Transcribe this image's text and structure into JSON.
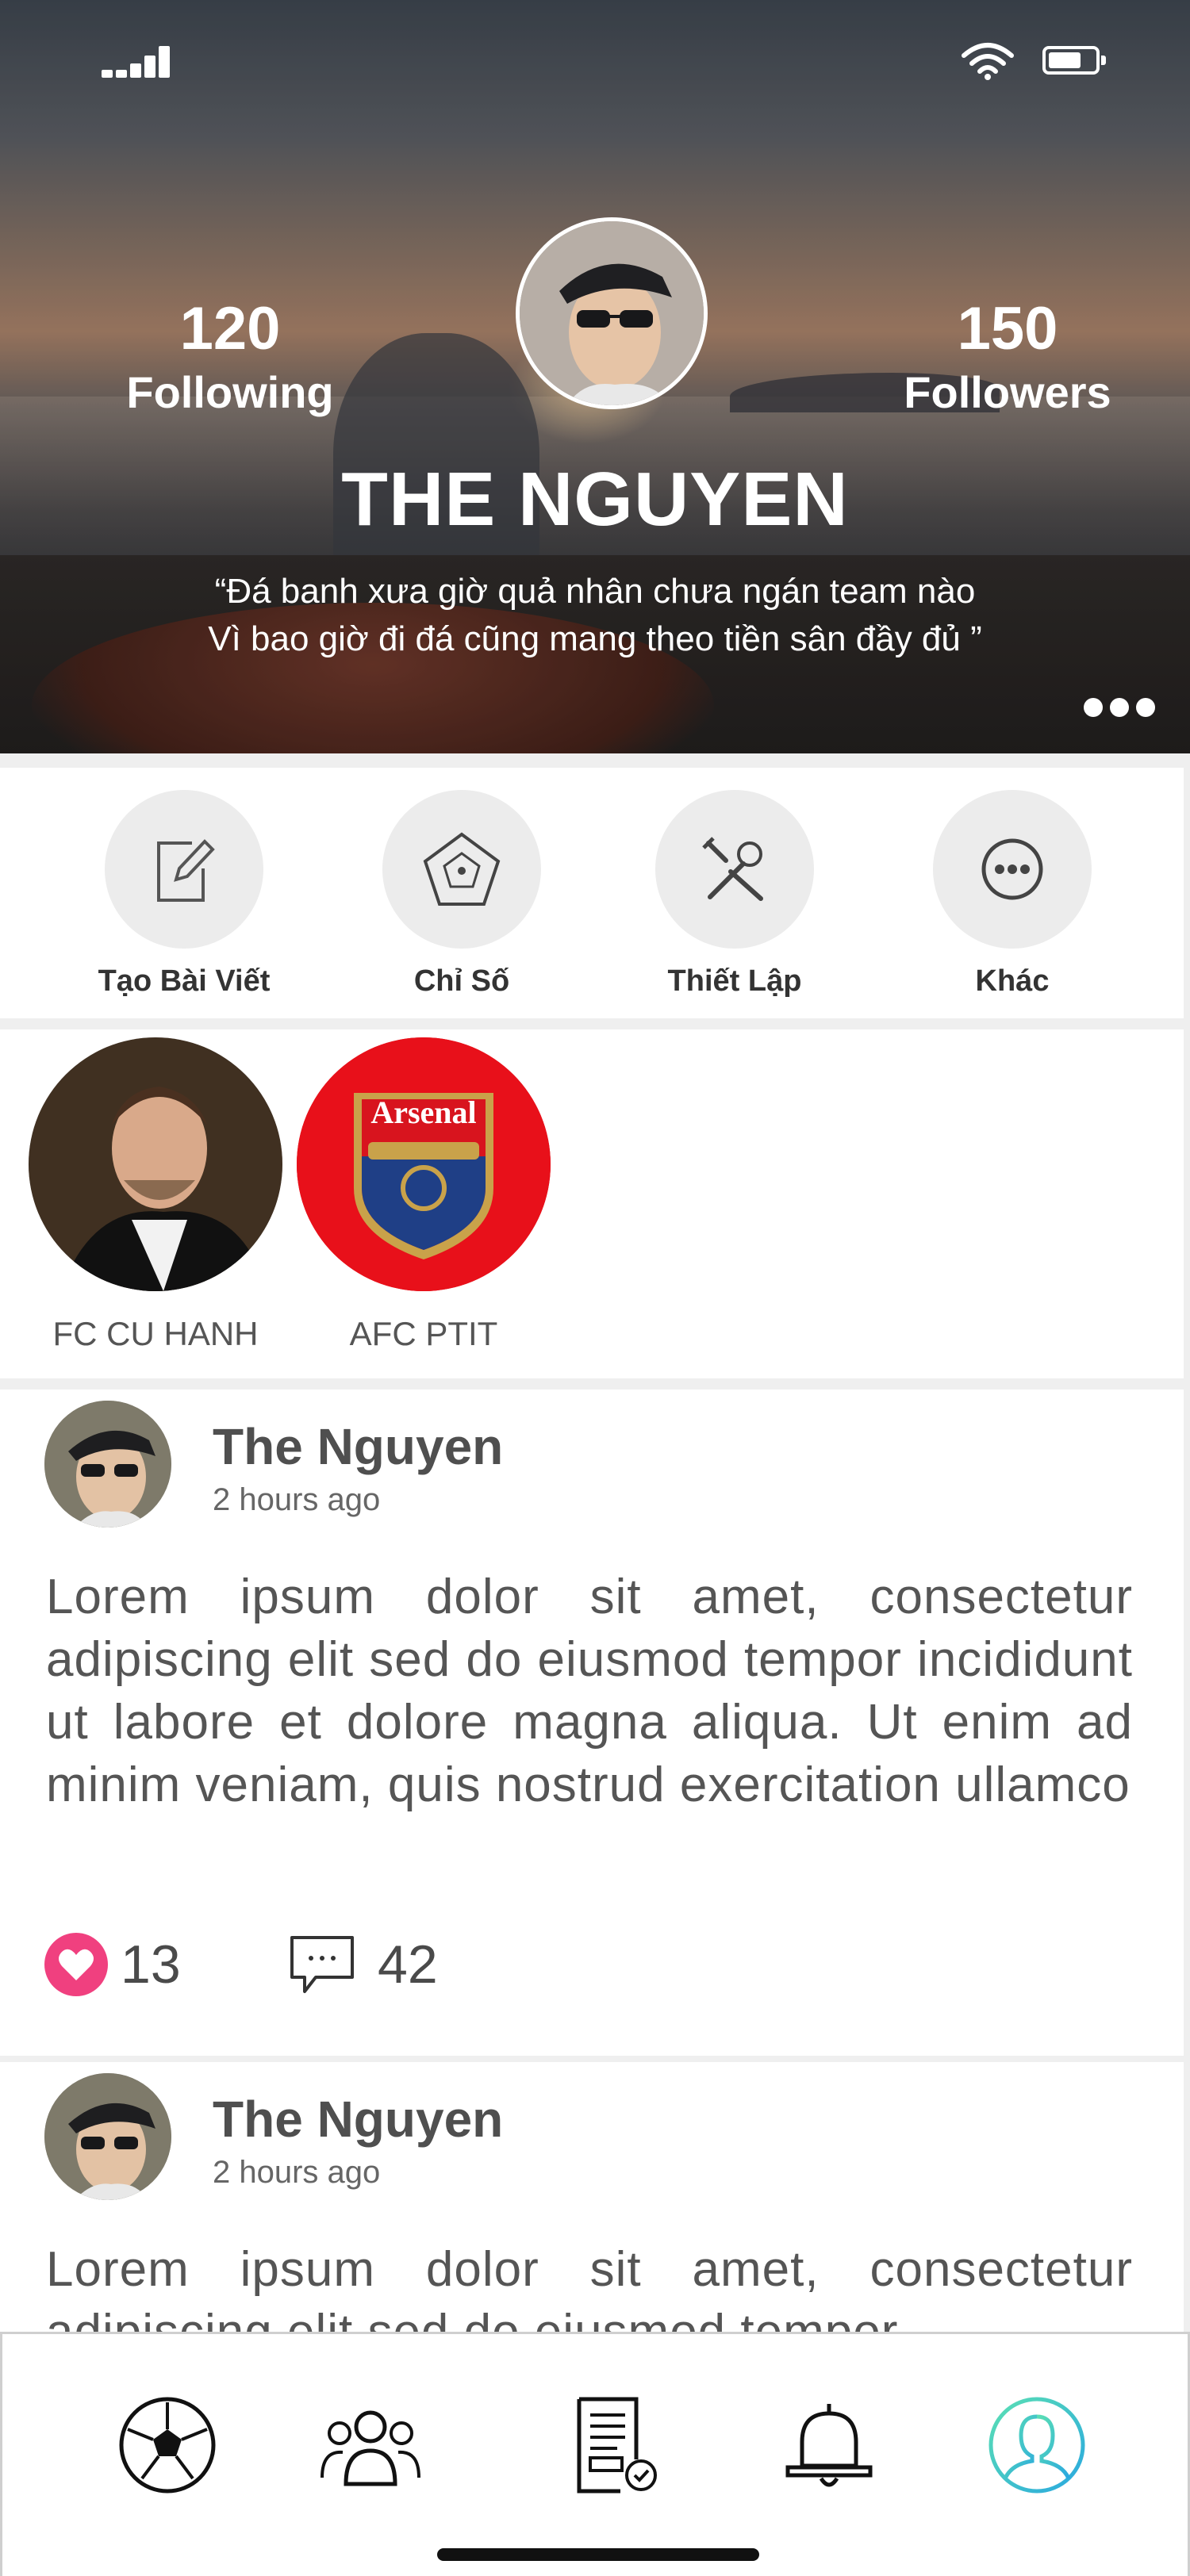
{
  "profile": {
    "following_count": "120",
    "following_label": "Following",
    "followers_count": "150",
    "followers_label": "Followers",
    "name": "THE NGUYEN",
    "quote_line1": "“Đá banh xưa giờ quả nhân chưa ngán team nào",
    "quote_line2": "Vì bao giờ đi đá cũng mang theo tiền sân đầy đủ ”"
  },
  "actions": [
    {
      "label": "Tạo Bài Viết",
      "icon": "edit-icon"
    },
    {
      "label": "Chỉ Số",
      "icon": "stats-pentagon-icon"
    },
    {
      "label": "Thiết Lập",
      "icon": "tools-icon"
    },
    {
      "label": "Khác",
      "icon": "more-icon"
    }
  ],
  "teams": [
    {
      "name": "FC CU HANH"
    },
    {
      "name": "AFC PTIT",
      "logo_text": "Arsenal"
    }
  ],
  "posts": [
    {
      "author": "The Nguyen",
      "time": "2 hours ago",
      "body": "Lorem ipsum dolor sit amet, consectetur adipiscing elit sed do eiusmod tempor incididunt ut labore et dolore magna aliqua. Ut enim ad minim veniam, quis nostrud exercitation ullamco",
      "likes": "13",
      "comments": "42"
    },
    {
      "author": "The Nguyen",
      "time": "2 hours ago",
      "body": "Lorem ipsum dolor sit amet, consectetur adipiscing elit sed do eiusmod tempor"
    }
  ],
  "nav": [
    {
      "icon": "soccer-ball-icon"
    },
    {
      "icon": "group-icon"
    },
    {
      "icon": "document-check-icon"
    },
    {
      "icon": "bell-icon"
    },
    {
      "icon": "profile-icon",
      "active": true
    }
  ],
  "colors": {
    "like": "#f0407f",
    "nav_active_start": "#5be0b3",
    "nav_active_end": "#2aa8e0",
    "arsenal_red": "#e8101a"
  }
}
